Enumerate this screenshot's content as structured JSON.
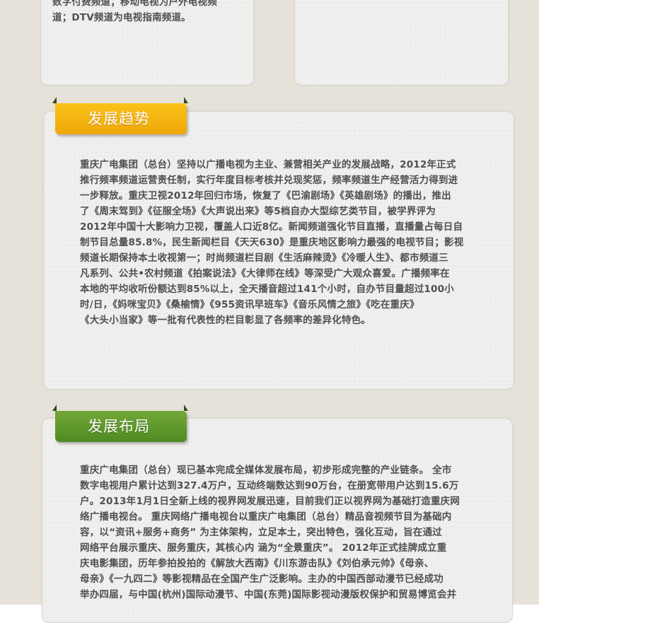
{
  "top_card": {
    "text_lines": [
      "数字付费频道；移动电视为户外电视频",
      "道；DTV频道为电视指南频道。"
    ]
  },
  "trend": {
    "title": "发展趋势",
    "colors": {
      "ribbon": "#f5b612"
    },
    "lines": [
      "重庆广电集团（总台）坚持以广播电视为主业、兼营相关产业的发展战略，2012年正式",
      "推行频率频道运营责任制，实行年度目标考核并兑现奖惩，频率频道生产经营活力得到进",
      "一步释放。重庆卫视2012年回归市场，恢复了《巴渝剧场》《英雄剧场》的播出，推出",
      "了《周末驾到》《征服全场》《大声说出来》等5档自办大型综艺类节目，被学界评为",
      "2012年中国十大影响力卫视，覆盖人口近8亿。新闻频道强化节目直播，直播量占每日自",
      "制节目总量85.8%，民生新闻栏目《天天630》是重庆地区影响力最强的电视节目；影视",
      "频道长期保持本土收视第一；时尚频道栏目剧《生活麻辣烫》《冷暖人生》、都市频道三",
      "凡系列、公共•农村频道《拍案说法》《大律师在线》等深受广大观众喜爱。广播频率在",
      "本地的平均收听份额达到85%以上，全天播音超过141个小时，自办节目量超过100小",
      "时/日，《妈咪宝贝》《桑榆情》《955资讯早班车》《音乐风情之旅》《吃在重庆》",
      "《大头小当家》等一批有代表性的栏目彰显了各频率的差异化特色。"
    ]
  },
  "layout": {
    "title": "发展布局",
    "colors": {
      "ribbon": "#62992c"
    },
    "lines": [
      "重庆广电集团（总台）现已基本完成全媒体发展布局，初步形成完整的产业链条。 全市",
      "数字电视用户累计达到327.4万户，互动终端数达到90万台，在册宽带用户达到15.6万",
      "户。2013年1月1日全新上线的视界网发展迅速，目前我们正以视界网为基础打造重庆网",
      "络广播电视台。 重庆网络广播电视台以重庆广电集团（总台）精品音视频节目为基础内",
      "容，以“资讯+服务+商务” 为主体架构，立足本土，突出特色，强化互动，旨在通过",
      "网络平台展示重庆、服务重庆，其核心内 涵为“全景重庆”。 2012年正式挂牌成立重",
      "庆电影集团，历年参拍投拍的《解放大西南》《川东游击队》《刘伯承元帅》《母亲、",
      "母亲》《一九四二》等影视精品在全国产生广泛影响。主办的中国西部动漫节已经成功",
      "举办四届，与中国(杭州)国际动漫节、中国(东莞)国际影视动漫版权保护和贸易博览会并"
    ]
  }
}
